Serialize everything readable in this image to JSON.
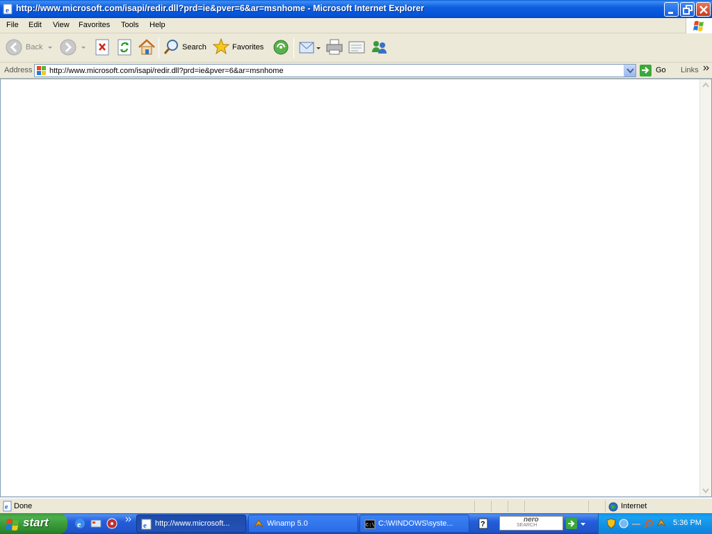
{
  "window": {
    "title": "http://www.microsoft.com/isapi/redir.dll?prd=ie&pver=6&ar=msnhome - Microsoft Internet Explorer"
  },
  "menu": [
    "File",
    "Edit",
    "View",
    "Favorites",
    "Tools",
    "Help"
  ],
  "toolbar": {
    "back": "Back",
    "search": "Search",
    "favorites": "Favorites"
  },
  "address": {
    "label": "Address",
    "url": "http://www.microsoft.com/isapi/redir.dll?prd=ie&pver=6&ar=msnhome",
    "go": "Go",
    "links": "Links"
  },
  "status": {
    "text": "Done",
    "zone": "Internet"
  },
  "taskbar": {
    "start": "start",
    "tasks": [
      {
        "label": "http://www.microsoft...",
        "icon": "ie-icon",
        "active": true
      },
      {
        "label": "Winamp 5.0",
        "icon": "winamp-icon",
        "active": false
      },
      {
        "label": "C:\\WINDOWS\\syste...",
        "icon": "cmd-icon",
        "active": false
      }
    ],
    "nero": {
      "title": "nero",
      "subtitle": "SEARCH"
    },
    "clock": "5:36 PM"
  },
  "colors": {
    "titlebar": "#0a5fd8",
    "taskbar": "#245edb",
    "start": "#3c9a3c",
    "tray": "#0f84dd"
  }
}
